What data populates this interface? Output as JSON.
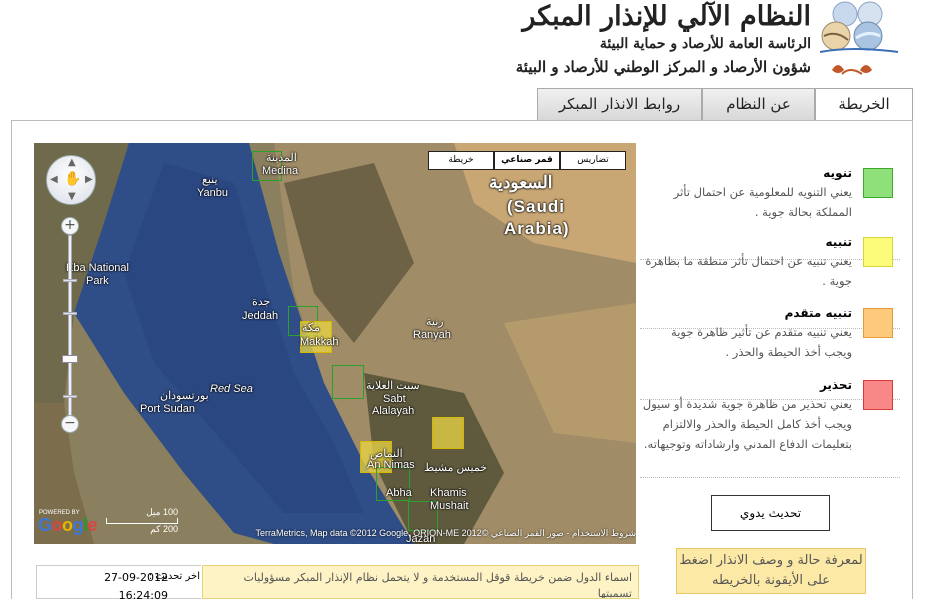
{
  "header": {
    "title": "النظام الآلي للإنذار المبكر",
    "subtitle1": "الرئاسة العامة للأرصاد و حماية البيئة",
    "subtitle2": "شؤون الأرصاد و المركز الوطني للأرصاد و البيئة"
  },
  "tabs": [
    {
      "label": "الخريطة",
      "active": true
    },
    {
      "label": "عن النظام",
      "active": false
    },
    {
      "label": "روابط الانذار المبكر",
      "active": false
    }
  ],
  "map": {
    "map_types": [
      "تضاريس",
      "قمر صناعي",
      "خريطة"
    ],
    "selected_type": "قمر صناعي",
    "labels": {
      "medina_ar": "المدينة",
      "medina": "Medina",
      "yanbu_ar": "ينبع",
      "yanbu": "Yanbu",
      "saudi_ar": "السعودية",
      "saudi_en1": "(Saudi",
      "saudi_en2": "Arabia)",
      "eba_park1": "Eba National",
      "eba_park2": "Park",
      "jeddah_ar": "جدة",
      "jeddah": "Jeddah",
      "makkah_ar": "مكة",
      "makkah": "Makkah",
      "ranyah_ar": "رنية",
      "ranyah": "Ranyah",
      "port_sudan_ar": "بورتسودان",
      "port_sudan": "Port Sudan",
      "red_sea": "Red Sea",
      "sabt_ar": "سبت العلاية",
      "sabt1": "Sabt",
      "sabt2": "Alalayah",
      "nimas_ar": "النماص",
      "nimas": "An Nimas",
      "khamis_ar": "خميس مشيط",
      "khamis1": "Khamis",
      "khamis2": "Mushait",
      "abha": "Abha",
      "jazan": "Jazan"
    },
    "scale_top": "100 ميل",
    "scale_bottom": "200 كم",
    "powered_by": "POWERED BY",
    "google": "Google",
    "copyright": "شروط الاستخدام - صور القمر الصناعي ©2012 TerraMetrics, Map data ©2012 Google, ORION-ME"
  },
  "legend": [
    {
      "title": "تنويه",
      "description": "يعني التنويه للمعلومية عن احتمال تأثر المملكة بحالة جوية .",
      "color": "#8fe07a",
      "border": "#3cab2a"
    },
    {
      "title": "تنبيه",
      "description": "يعني تنبيه عن احتمال تأثر منطقة ما بظاهرة جوية .",
      "color": "#fdfb7a",
      "border": "#d8d437"
    },
    {
      "title": "تنبيه متقدم",
      "description": "يعني تنبيه متقدم عن تأثير ظاهرة جوية ويجب أخذ الحيطة والحذر .",
      "color": "#fdc97a",
      "border": "#e29a3c"
    },
    {
      "title": "تحذير",
      "description": "يعني تحذير من ظاهرة جوية شديدة أو سيول ويجب أخذ كامل الحيطة والحذر والالتزام بتعليمات الدفاع المدني وارشاداته وتوجيهاته.",
      "color": "#f88888",
      "border": "#d83a3a"
    }
  ],
  "update_button": "تحديث يدوي",
  "info_box": "لمعرفة حالة و وصف الانذار اضغط على الأيقونة بالخريطه",
  "last_update": {
    "label": "اخر تحديث :",
    "date": "27-09-2012",
    "time": "16:24:09"
  },
  "disclaimer": "اسماء الدول ضمن خريطة قوقل المستخدمة و لا يتحمل نظام الإنذار المبكر مسؤوليات تسميتها"
}
